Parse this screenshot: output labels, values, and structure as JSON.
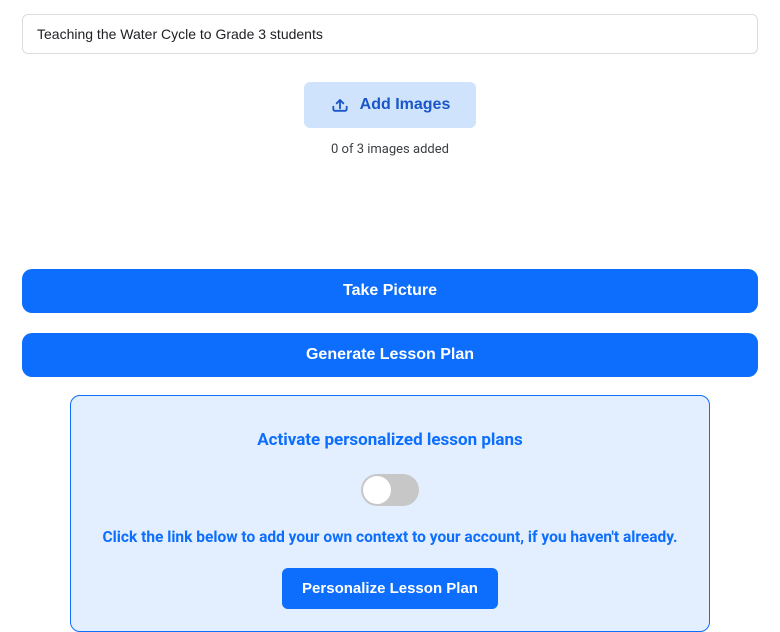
{
  "topic": {
    "value": "Teaching the Water Cycle to Grade 3 students"
  },
  "images": {
    "add_label": "Add Images",
    "count_text": "0 of 3 images added"
  },
  "actions": {
    "take_picture": "Take Picture",
    "generate": "Generate Lesson Plan"
  },
  "panel": {
    "title": "Activate personalized lesson plans",
    "subtitle": "Click the link below to add your own context to your account, if you haven't already.",
    "personalize_button": "Personalize Lesson Plan"
  }
}
